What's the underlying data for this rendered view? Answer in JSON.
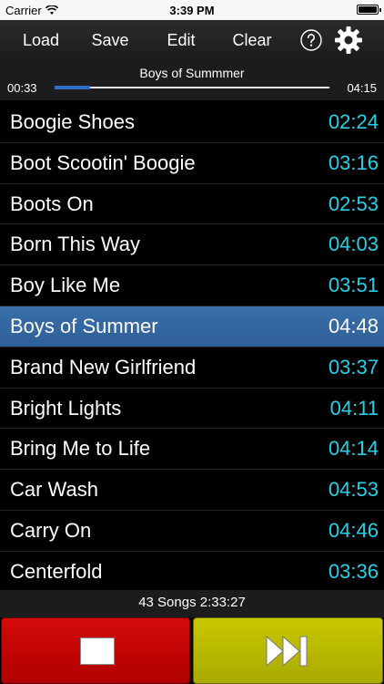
{
  "status_bar": {
    "carrier": "Carrier",
    "time": "3:39 PM"
  },
  "toolbar": {
    "load_label": "Load",
    "save_label": "Save",
    "edit_label": "Edit",
    "clear_label": "Clear",
    "help_icon": "question-circle-icon",
    "settings_icon": "gear-icon"
  },
  "now_playing": {
    "title": "Boys of Summmer",
    "elapsed": "00:33",
    "total": "04:15",
    "progress_fraction": 0.129
  },
  "songs": [
    {
      "title": "Boogie Shoes",
      "duration": "02:24",
      "selected": false
    },
    {
      "title": "Boot Scootin' Boogie",
      "duration": "03:16",
      "selected": false
    },
    {
      "title": "Boots On",
      "duration": "02:53",
      "selected": false
    },
    {
      "title": "Born This Way",
      "duration": "04:03",
      "selected": false
    },
    {
      "title": "Boy Like Me",
      "duration": "03:51",
      "selected": false
    },
    {
      "title": "Boys of Summer",
      "duration": "04:48",
      "selected": true
    },
    {
      "title": "Brand New Girlfriend",
      "duration": "03:37",
      "selected": false
    },
    {
      "title": "Bright Lights",
      "duration": "04:11",
      "selected": false
    },
    {
      "title": "Bring Me to Life",
      "duration": "04:14",
      "selected": false
    },
    {
      "title": "Car Wash",
      "duration": "04:53",
      "selected": false
    },
    {
      "title": "Carry On",
      "duration": "04:46",
      "selected": false
    },
    {
      "title": "Centerfold",
      "duration": "03:36",
      "selected": false
    }
  ],
  "summary": {
    "text": "43 Songs 2:33:27"
  },
  "transport": {
    "stop_icon": "stop-icon",
    "next_icon": "skip-next-icon",
    "stop_color": "#c80000",
    "next_color": "#bcbc00"
  },
  "colors": {
    "duration_text": "#26d0e8",
    "selected_row": "#3468a3",
    "progress_fill": "#2f6fc8"
  }
}
